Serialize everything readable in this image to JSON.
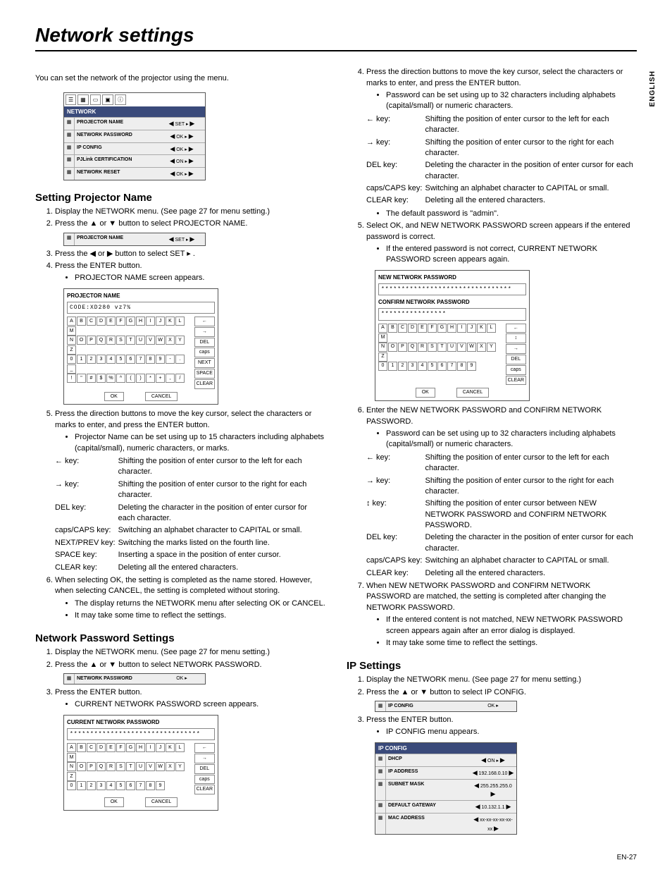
{
  "page": {
    "title": "Network settings",
    "side_label": "ENGLISH",
    "page_number": "EN-27",
    "intro": "You can set the network of the projector using the menu."
  },
  "network_menu": {
    "header": "NETWORK",
    "rows": [
      {
        "label": "PROJECTOR NAME",
        "value": "SET ▸"
      },
      {
        "label": "NETWORK PASSWORD",
        "value": "OK ▸"
      },
      {
        "label": "IP CONFIG",
        "value": "OK ▸"
      },
      {
        "label": "PJLink CERTIFICATION",
        "value": "ON ▸"
      },
      {
        "label": "NETWORK RESET",
        "value": "OK ▸"
      }
    ]
  },
  "section_projector_name": {
    "heading": "Setting Projector Name",
    "steps": [
      "Display the NETWORK menu. (See page 27 for menu setting.)",
      "Press the ▲ or ▼ button to select PROJECTOR NAME.",
      "Press the ◀ or ▶ button to select SET ▸ .",
      "Press the ENTER button.",
      "Press the direction buttons to move the key cursor, select the characters or marks to enter, and press the ENTER button.",
      "When selecting OK, the setting is completed as the name stored. However, when selecting CANCEL, the setting is completed without storing."
    ],
    "bullets_after_4": [
      "PROJECTOR NAME screen appears."
    ],
    "bullets_after_5": [
      "Projector Name can be set using up to 15 characters including alphabets (capital/small), numeric characters, or marks."
    ],
    "bullets_after_6": [
      "The display returns the NETWORK menu after selecting OK or CANCEL.",
      "It may take some time to reflect the settings."
    ],
    "single_row": {
      "label": "PROJECTOR NAME",
      "value": "SET ▸"
    },
    "osk": {
      "title": "PROJECTOR NAME",
      "input": "CODE:XD280 vz7%",
      "row1": [
        "A",
        "B",
        "C",
        "D",
        "E",
        "F",
        "G",
        "H",
        "I",
        "J",
        "K",
        "L",
        "M"
      ],
      "row2": [
        "N",
        "O",
        "P",
        "Q",
        "R",
        "S",
        "T",
        "U",
        "V",
        "W",
        "X",
        "Y",
        "Z"
      ],
      "row3": [
        "0",
        "1",
        "2",
        "3",
        "4",
        "5",
        "6",
        "7",
        "8",
        "9",
        "-",
        ".",
        "_"
      ],
      "row4": [
        "!",
        "\"",
        "#",
        "$",
        "%",
        "^",
        "(",
        ")",
        "*",
        "+",
        ",",
        "/"
      ],
      "side": [
        "←",
        "→",
        "DEL",
        "caps",
        "NEXT",
        "SPACE",
        "CLEAR"
      ],
      "ok": "OK",
      "cancel": "CANCEL"
    },
    "keys": [
      {
        "k": "← key:",
        "d": "Shifting the position of enter cursor to the left for each character."
      },
      {
        "k": "→ key:",
        "d": "Shifting the position of enter cursor to the right for each character."
      },
      {
        "k": "DEL key:",
        "d": "Deleting the character in the position of enter cursor for each character."
      },
      {
        "k": "caps/CAPS key:",
        "d": "Switching an alphabet character to CAPITAL or small."
      },
      {
        "k": "NEXT/PREV key:",
        "d": "Switching the marks listed on the fourth line."
      },
      {
        "k": "SPACE key:",
        "d": "Inserting a space in the position of enter cursor."
      },
      {
        "k": "CLEAR key:",
        "d": "Deleting all the entered characters."
      }
    ]
  },
  "section_password": {
    "heading": "Network Password Settings",
    "steps_left": [
      "Display the NETWORK menu. (See page 27 for menu setting.)",
      "Press the ▲ or ▼ button to select NETWORK PASSWORD.",
      "Press the ENTER button."
    ],
    "bullet_after_3": [
      "CURRENT NETWORK PASSWORD screen appears."
    ],
    "single_row": {
      "label": "NETWORK PASSWORD",
      "value": "OK ▸"
    },
    "osk_current": {
      "title": "CURRENT NETWORK PASSWORD",
      "input": "********************************",
      "row1": [
        "A",
        "B",
        "C",
        "D",
        "E",
        "F",
        "G",
        "H",
        "I",
        "J",
        "K",
        "L",
        "M"
      ],
      "row2": [
        "N",
        "O",
        "P",
        "Q",
        "R",
        "S",
        "T",
        "U",
        "V",
        "W",
        "X",
        "Y",
        "Z"
      ],
      "row3": [
        "0",
        "1",
        "2",
        "3",
        "4",
        "5",
        "6",
        "7",
        "8",
        "9"
      ],
      "side": [
        "←",
        "→",
        "DEL",
        "caps",
        "CLEAR"
      ],
      "ok": "OK",
      "cancel": "CANCEL"
    },
    "step4": "Press the direction buttons to move the key cursor, select the characters or marks to enter, and press the ENTER button.",
    "bullet_after_4": [
      "Password can be set using up to 32 characters including alphabets (capital/small) or numeric characters."
    ],
    "keys_4": [
      {
        "k": "← key:",
        "d": "Shifting the position of enter cursor to the left for each character."
      },
      {
        "k": "→ key:",
        "d": "Shifting the position of enter cursor to the right for each character."
      },
      {
        "k": "DEL key:",
        "d": "Deleting the character in the position of enter cursor for each character."
      },
      {
        "k": "caps/CAPS key:",
        "d": "Switching an alphabet character to CAPITAL or small."
      },
      {
        "k": "CLEAR key:",
        "d": "Deleting all the entered characters."
      }
    ],
    "bullet_default": "The default password is \"admin\".",
    "step5": "Select OK, and NEW NETWORK PASSWORD screen appears if the entered password is correct.",
    "bullet_after_5": [
      "If the entered password is not correct, CURRENT NETWORK PASSWORD screen appears again."
    ],
    "osk_new": {
      "title1": "NEW NETWORK PASSWORD",
      "input1": "********************************",
      "title2": "CONFIRM NETWORK PASSWORD",
      "input2": "****************",
      "row1": [
        "A",
        "B",
        "C",
        "D",
        "E",
        "F",
        "G",
        "H",
        "I",
        "J",
        "K",
        "L",
        "M"
      ],
      "row2": [
        "N",
        "O",
        "P",
        "Q",
        "R",
        "S",
        "T",
        "U",
        "V",
        "W",
        "X",
        "Y",
        "Z"
      ],
      "row3": [
        "0",
        "1",
        "2",
        "3",
        "4",
        "5",
        "6",
        "7",
        "8",
        "9"
      ],
      "side": [
        "←",
        "↕",
        "→",
        "DEL",
        "caps",
        "CLEAR"
      ],
      "ok": "OK",
      "cancel": "CANCEL"
    },
    "step6": "Enter the NEW NETWORK PASSWORD and CONFIRM NETWORK PASSWORD.",
    "bullet_after_6": [
      "Password can be set using up to 32 characters including alphabets (capital/small) or numeric characters."
    ],
    "keys_6": [
      {
        "k": "← key:",
        "d": "Shifting the position of enter cursor to the left for each character."
      },
      {
        "k": "→ key:",
        "d": "Shifting the position of enter cursor to the right for each character."
      },
      {
        "k": "↕ key:",
        "d": "Shifting the position of enter cursor between NEW NETWORK PASSWORD and CONFIRM NETWORK PASSWORD."
      },
      {
        "k": "DEL key:",
        "d": "Deleting the character in the position of enter cursor for each character."
      },
      {
        "k": "caps/CAPS key:",
        "d": "Switching an alphabet character to CAPITAL or small."
      },
      {
        "k": "CLEAR key:",
        "d": "Deleting all the entered characters."
      }
    ],
    "step7": "When NEW NETWORK PASSWORD and CONFIRM NETWORK PASSWORD are matched, the setting is completed after changing the NETWORK PASSWORD.",
    "bullets_after_7": [
      "If the entered content is not matched, NEW NETWORK PASSWORD screen appears again after an error dialog is displayed.",
      "It may take some time to reflect the settings."
    ]
  },
  "section_ip": {
    "heading": "IP Settings",
    "steps": [
      "Display the NETWORK menu. (See page 27 for menu setting.)",
      "Press the ▲ or ▼ button to select IP CONFIG.",
      "Press the ENTER button."
    ],
    "single_row": {
      "label": "IP CONFIG",
      "value": "OK ▸"
    },
    "bullet_after_3": [
      "IP CONFIG menu appears."
    ],
    "menu": {
      "header": "IP CONFIG",
      "rows": [
        {
          "label": "DHCP",
          "value": "ON ▸"
        },
        {
          "label": "IP ADDRESS",
          "value": "192.168.0.10"
        },
        {
          "label": "SUBNET MASK",
          "value": "255.255.255.0"
        },
        {
          "label": "DEFAULT GATEWAY",
          "value": "10.132.1.1"
        },
        {
          "label": "MAC ADDRESS",
          "value": "xx-xx-xx-xx-xx-xx"
        }
      ]
    }
  }
}
